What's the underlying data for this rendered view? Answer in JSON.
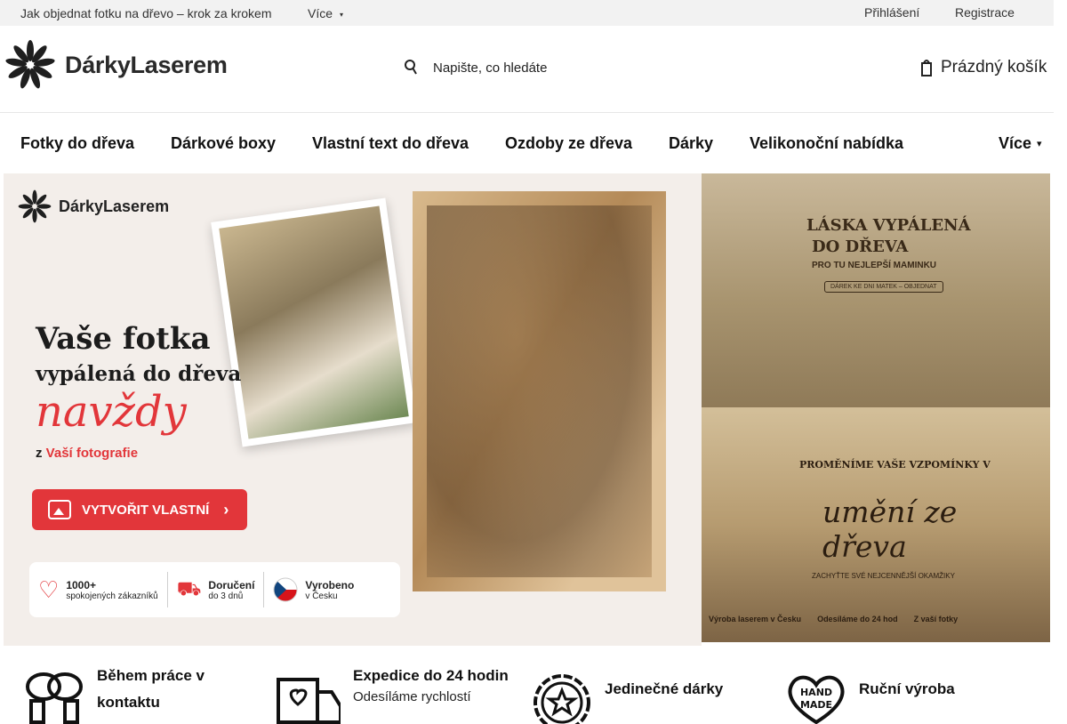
{
  "topbar": {
    "link": "Jak objednat fotku na dřevo – krok za krokem",
    "more": "Více",
    "login": "Přihlášení",
    "register": "Registrace"
  },
  "header": {
    "logo_text": "DárkyLaserem",
    "search_placeholder": "Napište, co hledáte",
    "cart": "Prázdný košík"
  },
  "nav": {
    "items": [
      "Fotky do dřeva",
      "Dárkové boxy",
      "Vlastní text do dřeva",
      "Ozdoby ze dřeva",
      "Dárky",
      "Velikonoční nabídka"
    ],
    "more": "Více"
  },
  "banner_main": {
    "logo": "DárkyLaserem",
    "title": "Vaše fotka",
    "subtitle": "vypálená do dřeva",
    "script": "navždy",
    "from_prefix": "z",
    "from_highlight": "Vaší fotografie",
    "cta": "VYTVOŘIT VLASTNÍ",
    "badges": [
      {
        "title": "1000+",
        "sub": "spokojených zákazníků"
      },
      {
        "title": "Doručení",
        "sub": "do 3 dnů"
      },
      {
        "title": "Vyrobeno",
        "sub": "v Česku"
      }
    ]
  },
  "banner_r1": {
    "line1": "LÁSKA VYPÁLENÁ",
    "line2": "DO DŘEVA",
    "line3": "PRO TU NEJLEPŠÍ MAMINKU",
    "button": "DÁREK KE DNI MATEK – OBJEDNAT"
  },
  "banner_r2": {
    "line1": "PROMĚNÍME VAŠE VZPOMÍNKY V",
    "line2": "umění ze dřeva",
    "line3": "ZACHYŤTE SVÉ NEJCENNĚJŠÍ OKAMŽIKY",
    "foot": [
      "Výroba laserem v Česku",
      "Odesíláme do 24 hod",
      "Z vaší fotky"
    ]
  },
  "features": [
    {
      "title": "Během práce v",
      "title2": "kontaktu",
      "sub": ""
    },
    {
      "title": "Expedice do 24 hodin",
      "title2": "",
      "sub": "Odesíláme rychlostí"
    },
    {
      "title": "Jedinečné dárky",
      "title2": "",
      "sub": ""
    },
    {
      "title": "Ruční výroba",
      "title2": "",
      "sub": ""
    }
  ],
  "colors": {
    "accent": "#e2363a",
    "topbar_bg": "#f2f2f2"
  }
}
